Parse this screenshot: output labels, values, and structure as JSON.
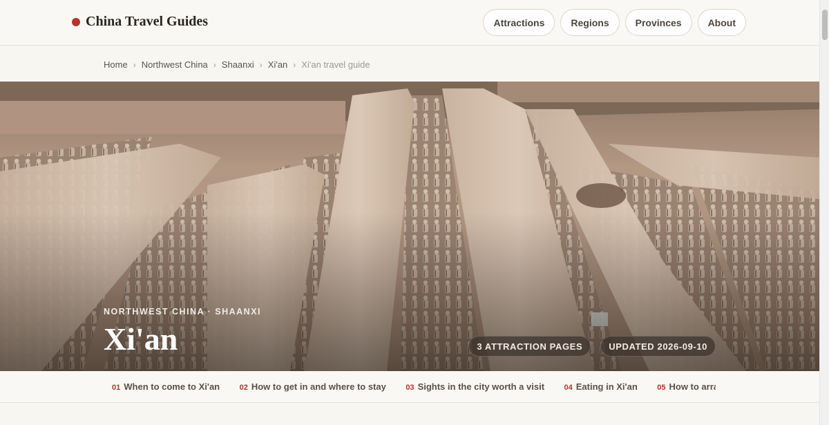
{
  "site": {
    "brand": "China Travel Guides",
    "brand_color": "#b3342a"
  },
  "nav": {
    "items": [
      {
        "label": "Attractions"
      },
      {
        "label": "Regions"
      },
      {
        "label": "Provinces"
      },
      {
        "label": "About"
      }
    ]
  },
  "breadcrumb": {
    "items": [
      {
        "label": "Home"
      },
      {
        "label": "Northwest China"
      },
      {
        "label": "Shaanxi"
      },
      {
        "label": "Xi'an"
      }
    ],
    "current": "Xi'an travel guide"
  },
  "hero": {
    "kicker": "NORTHWEST CHINA · SHAANXI",
    "title": "Xi'an",
    "badges": [
      {
        "label": "3 ATTRACTION PAGES"
      },
      {
        "label": "UPDATED 2026-09-10"
      }
    ]
  },
  "toc": {
    "items": [
      {
        "num": "01",
        "label": "When to come to Xi'an"
      },
      {
        "num": "02",
        "label": "How to get in and where to stay"
      },
      {
        "num": "03",
        "label": "Sights in the city worth a visit"
      },
      {
        "num": "04",
        "label": "Eating in Xi'an"
      },
      {
        "num": "05",
        "label": "How to arrange"
      }
    ]
  }
}
